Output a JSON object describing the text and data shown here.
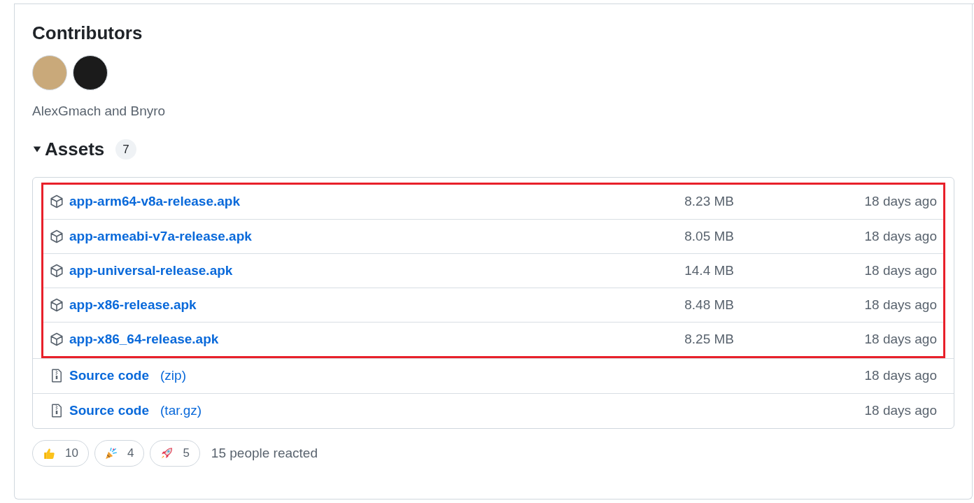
{
  "contributors": {
    "title": "Contributors",
    "avatars": [
      {
        "kind": "photo"
      },
      {
        "kind": "logo"
      }
    ],
    "names": "AlexGmach and Bnyro"
  },
  "assets": {
    "title": "Assets",
    "count": "7",
    "expanded": true,
    "rows": [
      {
        "kind": "package",
        "name": "app-arm64-v8a-release.apk",
        "size": "8.23 MB",
        "date": "18 days ago",
        "highlighted": true
      },
      {
        "kind": "package",
        "name": "app-armeabi-v7a-release.apk",
        "size": "8.05 MB",
        "date": "18 days ago",
        "highlighted": true
      },
      {
        "kind": "package",
        "name": "app-universal-release.apk",
        "size": "14.4 MB",
        "date": "18 days ago",
        "highlighted": true
      },
      {
        "kind": "package",
        "name": "app-x86-release.apk",
        "size": "8.48 MB",
        "date": "18 days ago",
        "highlighted": true
      },
      {
        "kind": "package",
        "name": "app-x86_64-release.apk",
        "size": "8.25 MB",
        "date": "18 days ago",
        "highlighted": true
      },
      {
        "kind": "archive",
        "name": "Source code",
        "format": "(zip)",
        "date": "18 days ago",
        "highlighted": false
      },
      {
        "kind": "archive",
        "name": "Source code",
        "format": "(tar.gz)",
        "date": "18 days ago",
        "highlighted": false
      }
    ]
  },
  "reactions": {
    "items": [
      {
        "kind": "thumbs-up",
        "count": "10"
      },
      {
        "kind": "party",
        "count": "4"
      },
      {
        "kind": "rocket",
        "count": "5"
      }
    ],
    "summary": "15 people reacted"
  }
}
